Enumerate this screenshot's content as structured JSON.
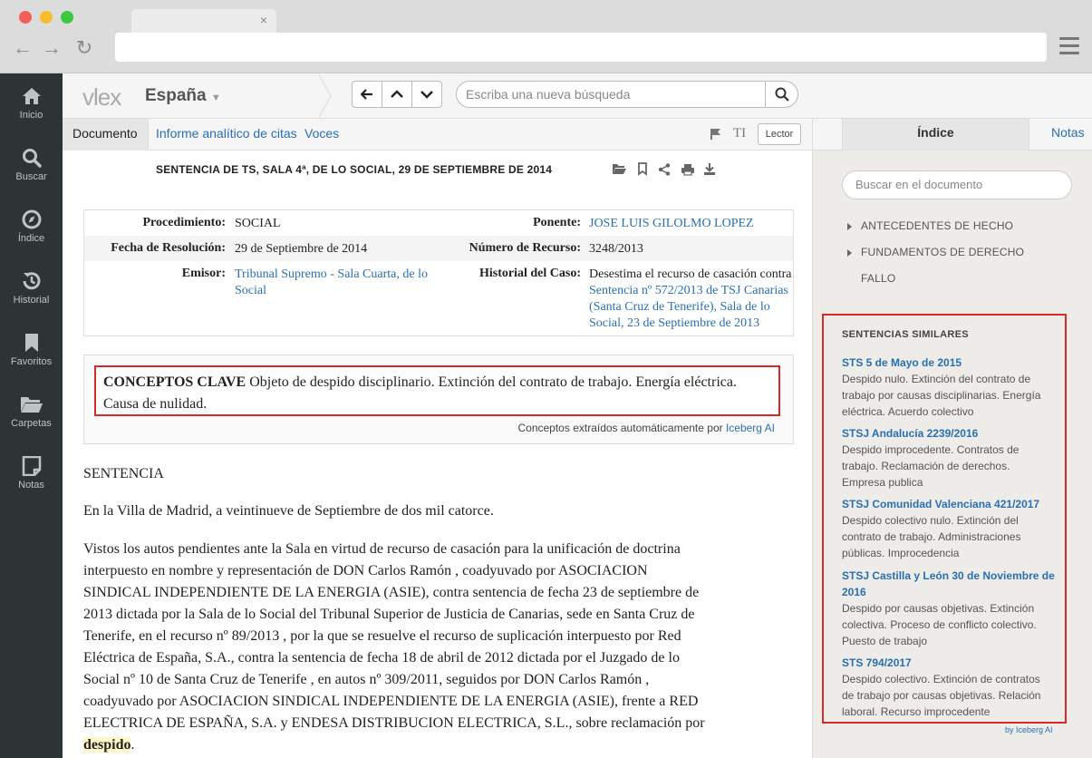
{
  "browser": {
    "tab_close": "×",
    "back": "←",
    "forward": "→",
    "reload": "↻"
  },
  "rail": [
    {
      "label": "Inicio",
      "icon": "home-icon"
    },
    {
      "label": "Buscar",
      "icon": "search-icon"
    },
    {
      "label": "Índice",
      "icon": "compass-icon"
    },
    {
      "label": "Historial",
      "icon": "history-icon"
    },
    {
      "label": "Favoritos",
      "icon": "bookmark-icon"
    },
    {
      "label": "Carpetas",
      "icon": "folder-icon"
    },
    {
      "label": "Notas",
      "icon": "note-icon"
    }
  ],
  "header": {
    "logo": "vlex",
    "country": "España",
    "search_placeholder": "Escriba una nueva búsqueda"
  },
  "doc_tabs": {
    "documento": "Documento",
    "informe": "Informe analítico de citas",
    "voces": "Voces",
    "lector": "Lector",
    "text_size": "TI"
  },
  "right_tabs": {
    "indice": "Índice",
    "notas": "Notas"
  },
  "document": {
    "title": "SENTENCIA DE TS, SALA 4ª, DE LO SOCIAL, 29 DE SEPTIEMBRE DE 2014",
    "meta": {
      "procedimiento_label": "Procedimiento:",
      "procedimiento": "SOCIAL",
      "ponente_label": "Ponente:",
      "ponente": "JOSE LUIS GILOLMO LOPEZ",
      "fecha_label": "Fecha de Resolución:",
      "fecha": "29 de Septiembre de 2014",
      "numero_label": "Número de Recurso:",
      "numero": "3248/2013",
      "emisor_label": "Emisor:",
      "emisor_1": "Tribunal Supremo - Sala Cuarta, de lo",
      "emisor_2": "Social",
      "historial_label": "Historial del Caso:",
      "historial_text": "Desestima el recurso de casación contra",
      "historial_link_1": "Sentencia nº 572/2013 de TSJ Canarias",
      "historial_link_2": "(Santa Cruz de Tenerife)",
      "historial_link_3": "Sala de lo",
      "historial_link_4": "Social, 23 de Septiembre de 2013"
    },
    "concepts": {
      "label": "CONCEPTOS CLAVE",
      "text": " Objeto de despido disciplinario. Extinción del contrato de trabajo. Energía eléctrica. Causa de nulidad.",
      "footer": "Conceptos extraídos automáticamente por ",
      "footer_link": "Iceberg AI"
    },
    "p1": "SENTENCIA",
    "p2": "En la Villa de Madrid, a veintinueve de Septiembre de dos mil catorce.",
    "p3_lines": [
      "Vistos los autos pendientes ante la Sala en virtud de recurso de casación para la unificación de doctrina",
      "interpuesto en nombre y representación de DON Carlos Ramón , coadyuvado por ASOCIACION",
      "SINDICAL INDEPENDIENTE DE LA ENERGIA (ASIE), contra sentencia de fecha 23 de septiembre de",
      "2013 dictada por la Sala de lo Social del Tribunal Superior de Justicia de Canarias, sede en Santa Cruz de",
      "Tenerife, en el recurso nº 89/2013 , por la que se resuelve el recurso de suplicación interpuesto por Red",
      "Eléctrica de España, S.A., contra la sentencia de fecha 18 de abril de 2012 dictada por el Juzgado de lo",
      "Social nº 10 de Santa Cruz de Tenerife , en autos nº 309/2011, seguidos por DON Carlos Ramón ,",
      "coadyuvado por ASOCIACION SINDICAL INDEPENDIENTE DE LA ENERGIA (ASIE), frente a RED",
      "ELECTRICA DE ESPAÑA, S.A. y ENDESA DISTRIBUCION ELECTRICA, S.L., sobre reclamación por"
    ],
    "p3_highlight": "despido",
    "p3_end": "."
  },
  "sidebar": {
    "search_placeholder": "Buscar en el documento",
    "index": [
      "ANTECEDENTES DE HECHO",
      "FUNDAMENTOS DE DERECHO",
      "FALLO"
    ],
    "similar_title": "SENTENCIAS SIMILARES",
    "similar": [
      {
        "title": "STS 5 de Mayo de 2015",
        "desc": [
          "Despido nulo. Extinción del contrato de",
          "trabajo por causas disciplinarias. Energía",
          "eléctrica. Acuerdo colectivo"
        ]
      },
      {
        "title": "STSJ Andalucía 2239/2016",
        "desc": [
          "Despido improcedente. Contratos de",
          "trabajo. Reclamación de derechos.",
          "Empresa publica"
        ]
      },
      {
        "title": "STSJ Comunidad Valenciana 421/2017",
        "desc": [
          "Despido colectivo nulo. Extinción del",
          "contrato de trabajo. Administraciones",
          "públicas. Improcedencia"
        ]
      },
      {
        "title": "STSJ Castilla y León 30 de Noviembre de 2016",
        "desc": [
          "Despido por causas objetivas. Extinción",
          "colectiva. Proceso de conflicto colectivo.",
          "Puesto de trabajo"
        ]
      },
      {
        "title": "STS 794/2017",
        "desc": [
          "Despido colectivo. Extinción de contratos",
          "de trabajo por causas objetivas. Relación",
          "laboral. Recurso improcedente"
        ]
      }
    ],
    "by_iceberg": "by Iceberg AI"
  }
}
